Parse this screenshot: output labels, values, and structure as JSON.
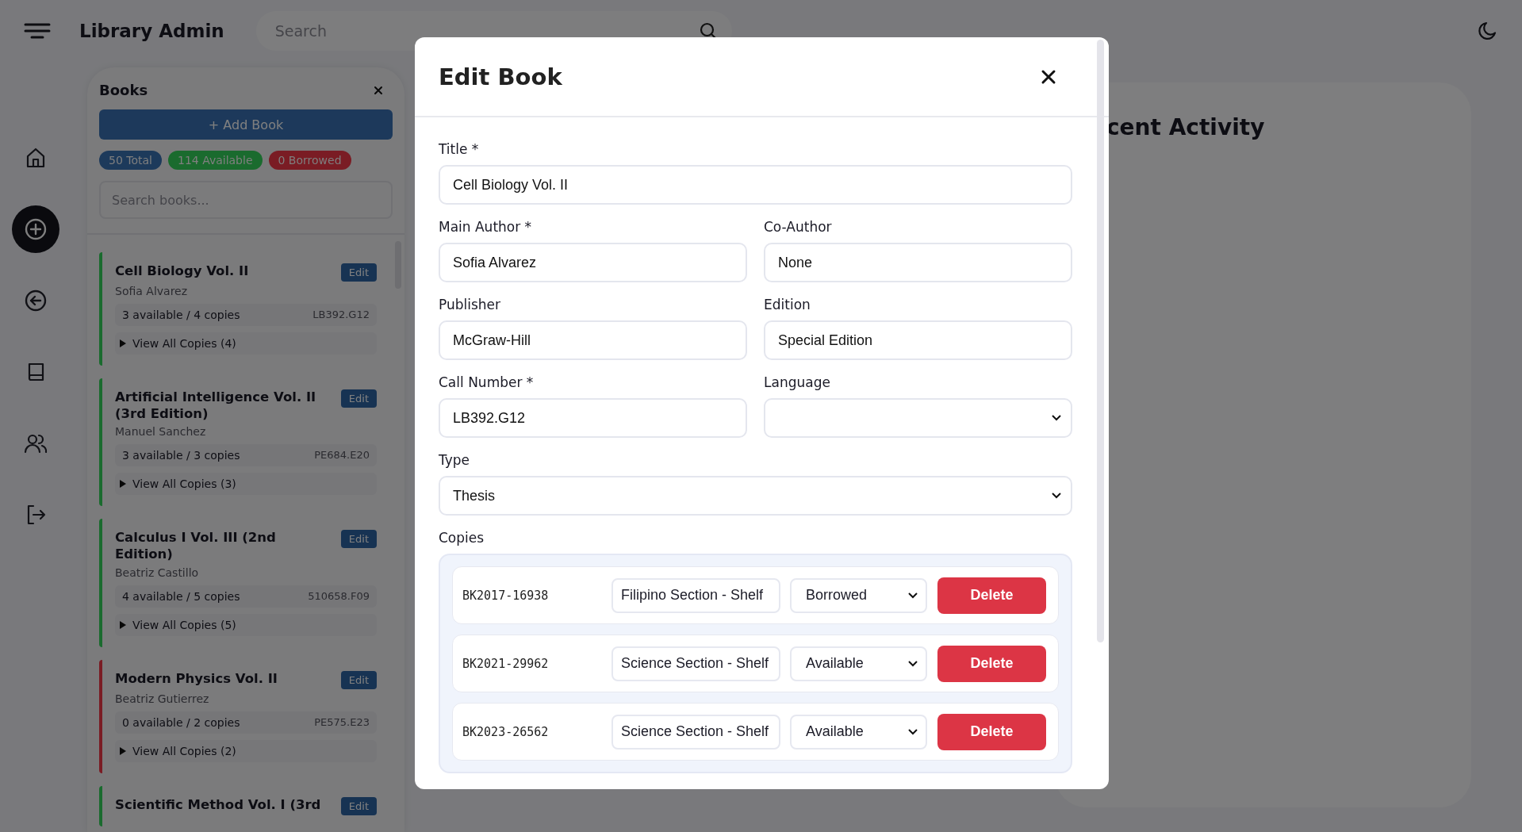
{
  "app": {
    "title": "Library Admin",
    "search_placeholder": "Search"
  },
  "nav": [
    {
      "selected": false
    },
    {
      "selected": true
    },
    {
      "selected": false
    },
    {
      "selected": false
    },
    {
      "selected": false
    },
    {
      "selected": false
    }
  ],
  "books_panel": {
    "title": "Books",
    "add_button": "+ Add Book",
    "search_placeholder": "Search books...",
    "badges": [
      {
        "label": "50 Total",
        "color": "#1d3a5b"
      },
      {
        "label": "114 Available",
        "color": "#1a6b2e"
      },
      {
        "label": "0 Borrowed",
        "color": "#7a1c24"
      }
    ],
    "books": [
      {
        "title": "Cell Biology Vol. II",
        "author": "Sofia Alvarez",
        "availability": "3 available / 4 copies",
        "call_number": "LB392.G12",
        "view_copies": "View All Copies (4)",
        "edit": "Edit",
        "color": "#1a6b2e"
      },
      {
        "title": "Artificial Intelligence Vol. II (3rd Edition)",
        "author": "Manuel Sanchez",
        "availability": "3 available / 3 copies",
        "call_number": "PE684.E20",
        "view_copies": "View All Copies (3)",
        "edit": "Edit",
        "color": "#1a6b2e"
      },
      {
        "title": "Calculus I Vol. III (2nd Edition)",
        "author": "Beatriz Castillo",
        "availability": "4 available / 5 copies",
        "call_number": "510658.F09",
        "view_copies": "View All Copies (5)",
        "edit": "Edit",
        "color": "#1a6b2e"
      },
      {
        "title": "Modern Physics Vol. II",
        "author": "Beatriz Gutierrez",
        "availability": "0 available / 2 copies",
        "call_number": "PE575.E23",
        "view_copies": "View All Copies (2)",
        "edit": "Edit",
        "color": "#7a1c24"
      },
      {
        "title": "Scientific Method Vol. I (3rd",
        "edit": "Edit",
        "color": "#1a6b2e"
      }
    ]
  },
  "recent_activity": {
    "title": "cent Activity"
  },
  "modal": {
    "title": "Edit Book",
    "rows": [
      [
        {
          "label": "Title *",
          "value": "Cell Biology Vol. II",
          "kind": "text"
        }
      ],
      [
        {
          "label": "Main Author *",
          "value": "Sofia Alvarez",
          "kind": "text"
        },
        {
          "label": "Co-Author",
          "value": "None",
          "kind": "text"
        }
      ],
      [
        {
          "label": "Publisher",
          "value": "McGraw-Hill",
          "kind": "text"
        },
        {
          "label": "Edition",
          "value": "Special Edition",
          "kind": "text"
        }
      ],
      [
        {
          "label": "Call Number *",
          "value": "LB392.G12",
          "kind": "text"
        },
        {
          "label": "Language",
          "kind": "select"
        }
      ],
      [
        {
          "label": "Type",
          "value": "Thesis",
          "kind": "select"
        }
      ]
    ],
    "copies_label": "Copies",
    "copies": [
      {
        "id": "BK2017-16938",
        "location": "Filipino Section - Shelf",
        "status": "Borrowed",
        "delete": "Delete"
      },
      {
        "id": "BK2021-29962",
        "location": "Science Section - Shelf",
        "status": "Available",
        "delete": "Delete"
      },
      {
        "id": "BK2023-26562",
        "location": "Science Section - Shelf",
        "status": "Available",
        "delete": "Delete"
      }
    ]
  }
}
